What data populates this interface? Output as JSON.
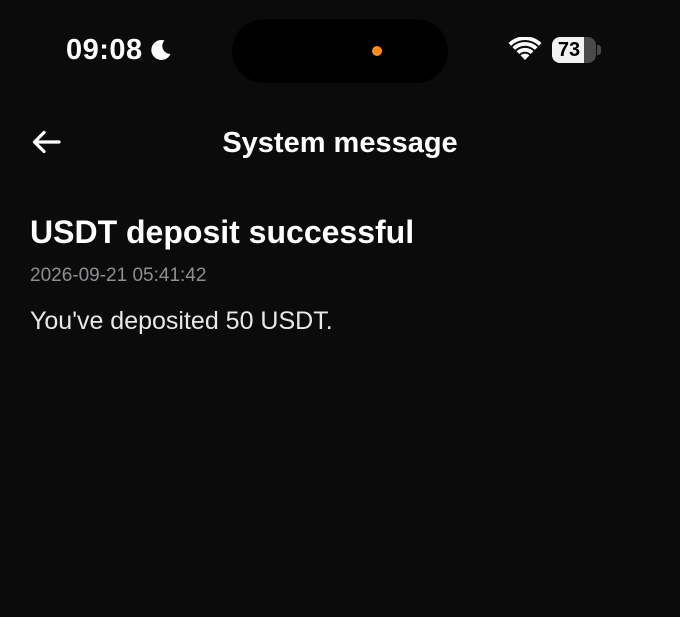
{
  "status_bar": {
    "time": "09:08",
    "battery_percent": 73,
    "battery_label": "73",
    "icons": [
      "moon-icon",
      "wifi-icon",
      "battery-icon"
    ],
    "island_dot_color": "#ff8a1f"
  },
  "nav": {
    "back_icon": "arrow-left-icon",
    "title": "System message"
  },
  "message": {
    "title": "USDT deposit successful",
    "timestamp": "2026-09-21 05:41:42",
    "body": "You've deposited 50 USDT."
  },
  "colors": {
    "background": "#0b0b0c",
    "text_primary": "#ffffff",
    "text_secondary": "#8e8e93"
  }
}
